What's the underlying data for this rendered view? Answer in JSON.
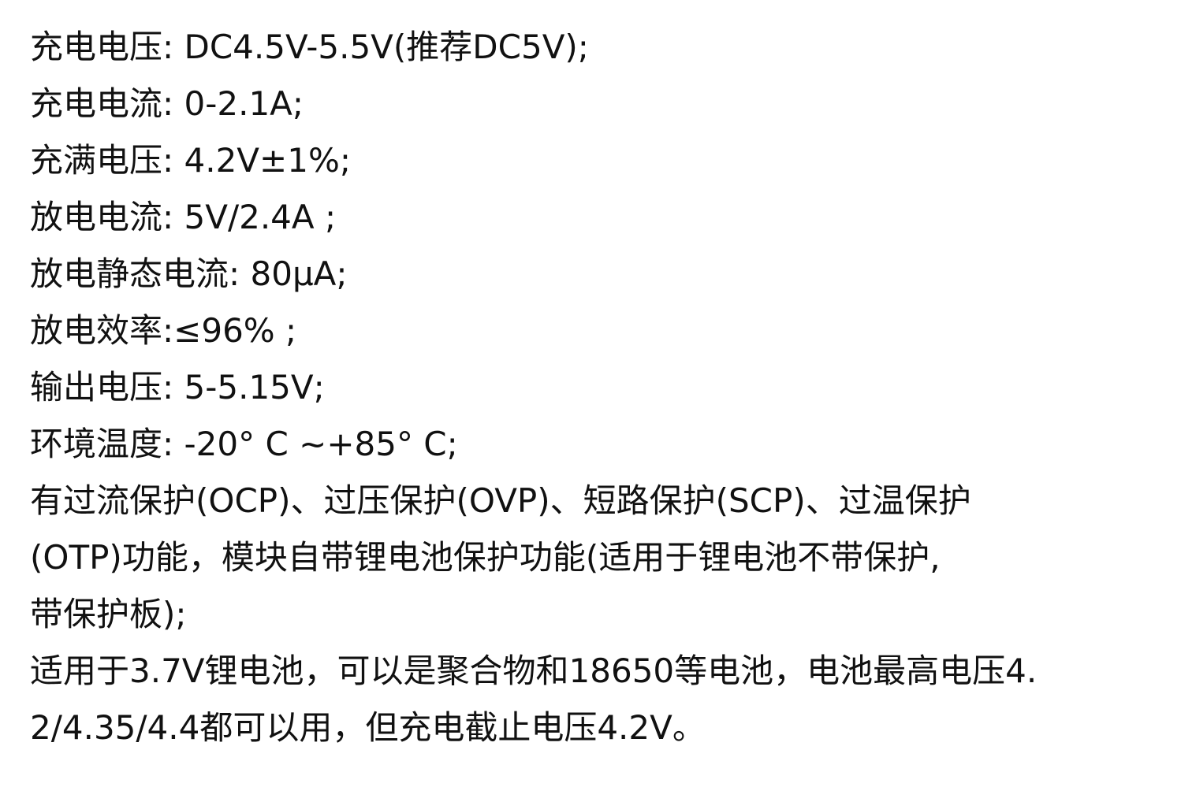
{
  "document": {
    "lines": [
      "充电电压: DC4.5V-5.5V(推荐DC5V);",
      "充电电流: 0-2.1A;",
      "充满电压: 4.2V±1%;",
      "放电电流: 5V/2.4A ;",
      "放电静态电流: 80μA;",
      "放电效率:≤96% ;",
      "输出电压: 5-5.15V;",
      "环境温度: -20° C ~+85° C;",
      "有过流保护(OCP)、过压保护(OVP)、短路保护(SCP)、过温保护",
      "(OTP)功能，模块自带锂电池保护功能(适用于锂电池不带保护,",
      "带保护板);",
      "适用于3.7V锂电池，可以是聚合物和18650等电池，电池最高电压4.",
      "2/4.35/4.4都可以用，但充电截止电压4.2V。"
    ]
  }
}
